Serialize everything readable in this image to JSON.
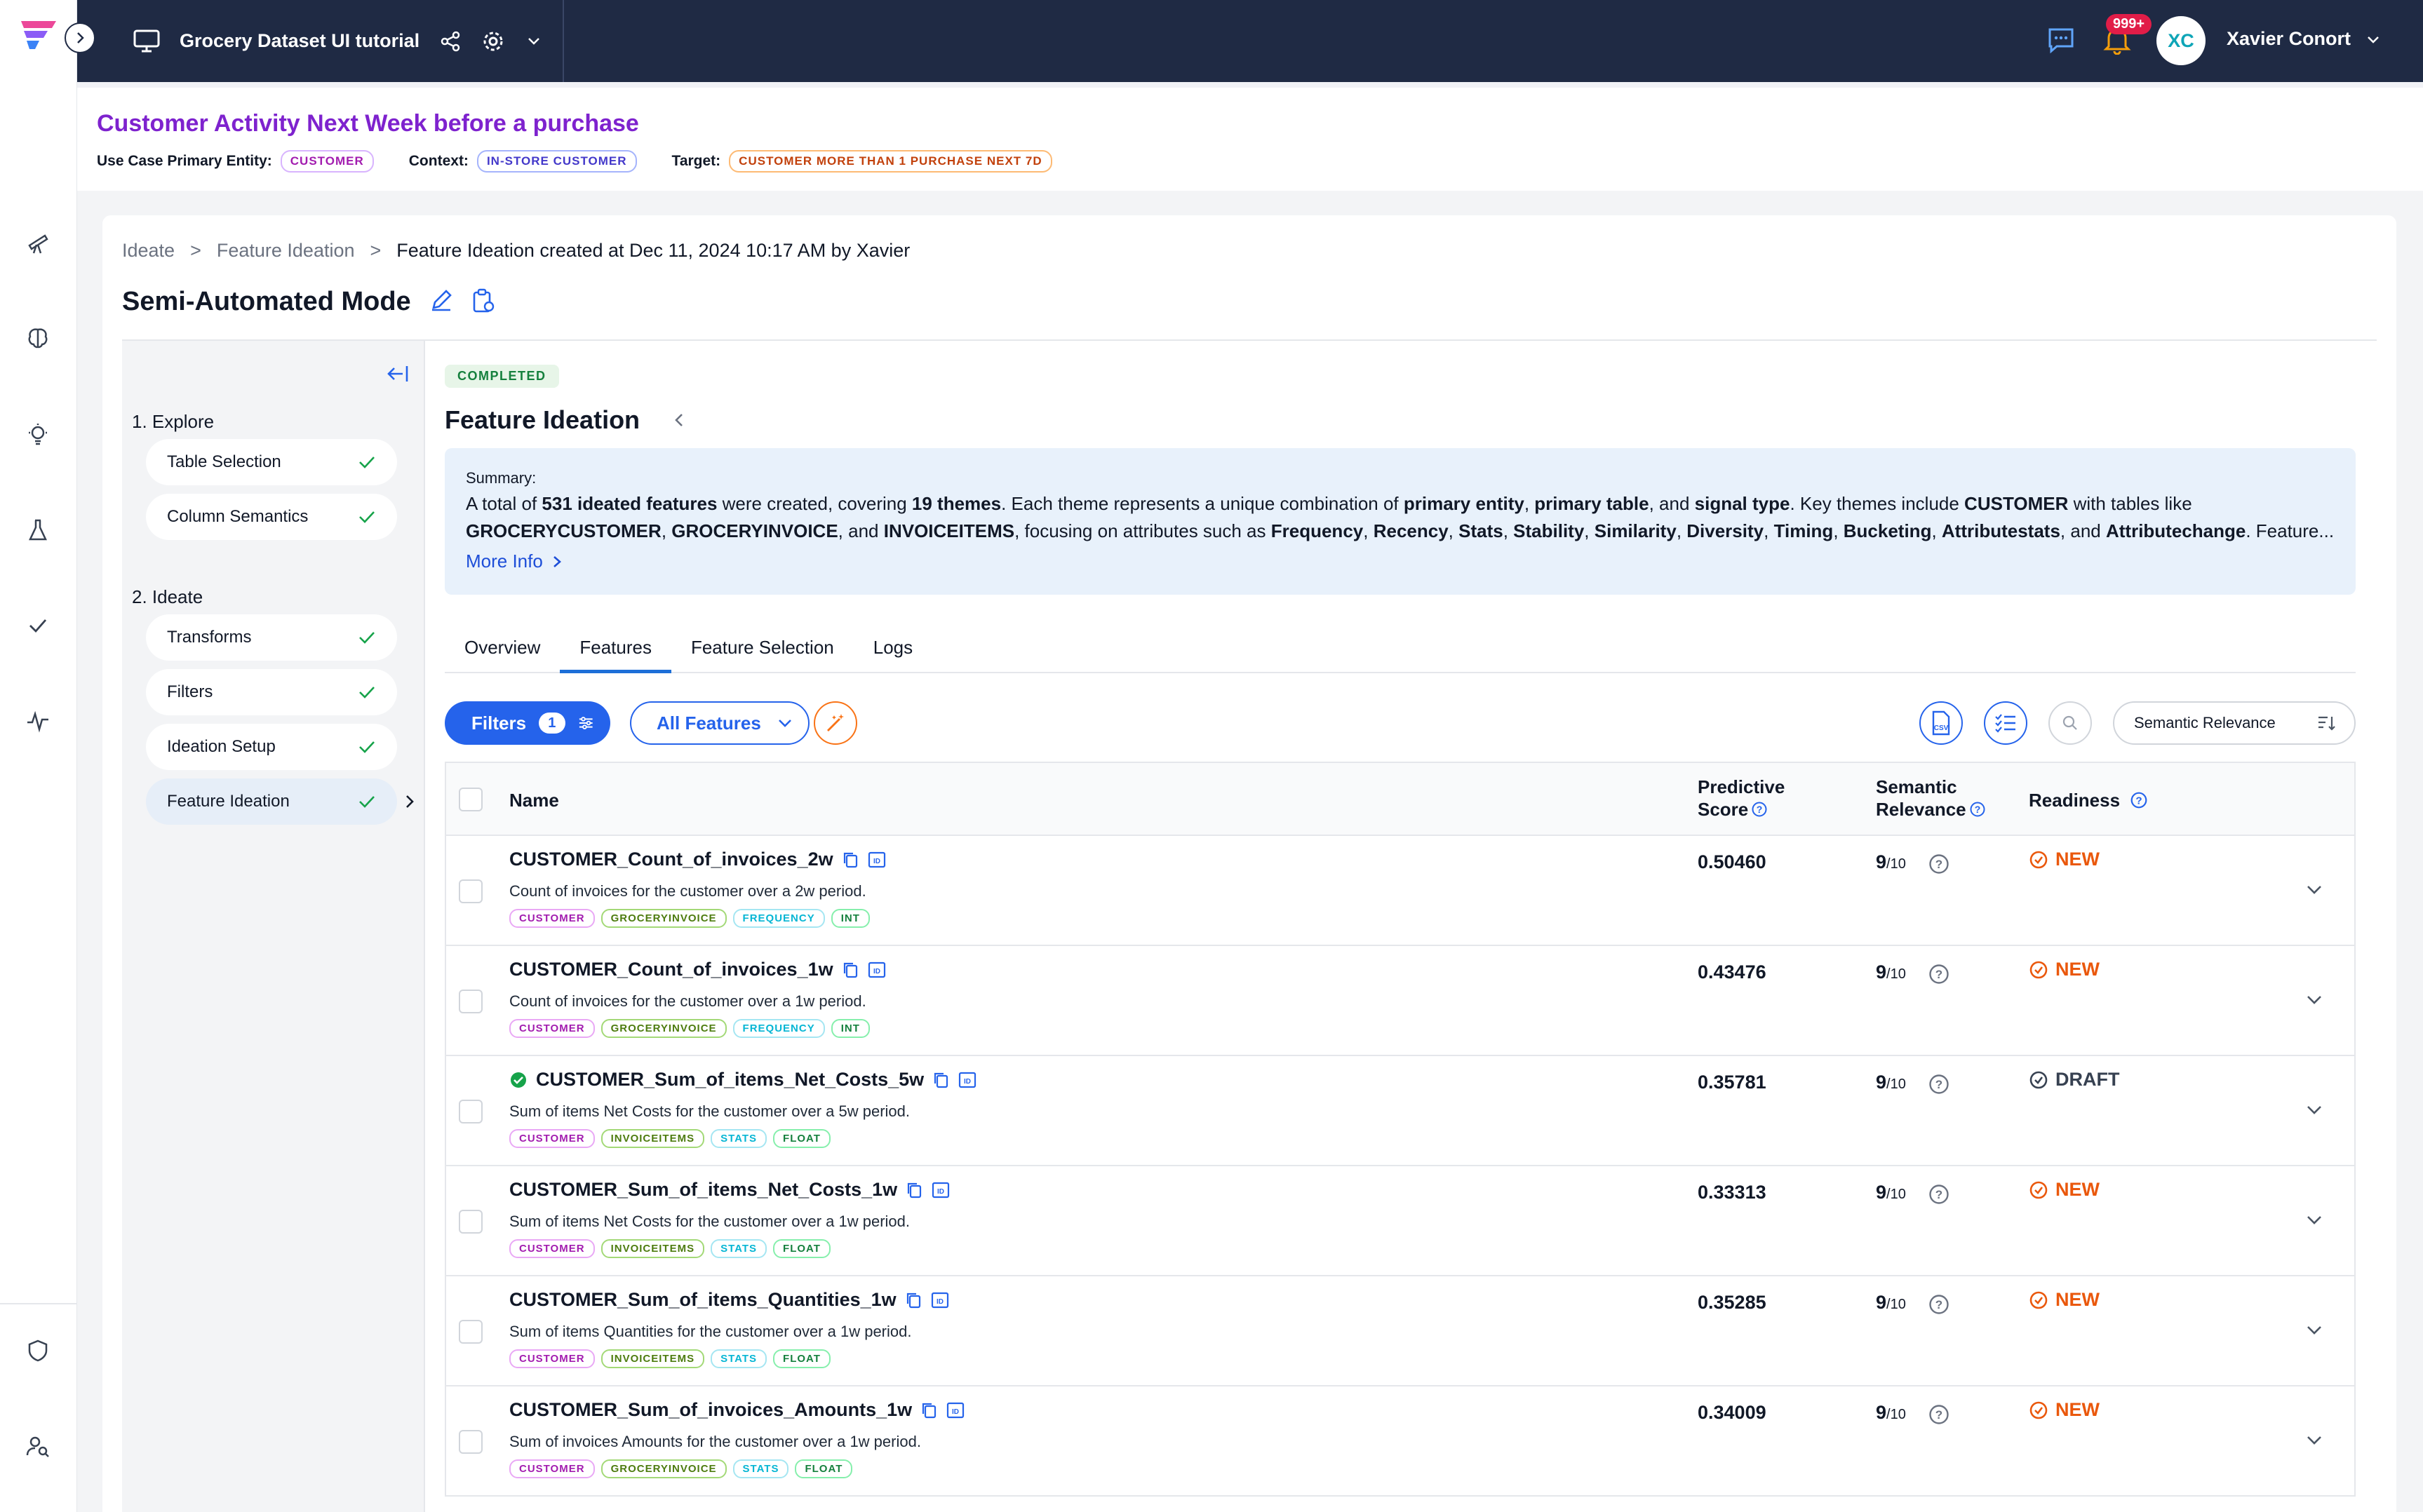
{
  "topbar": {
    "project_title": "Grocery Dataset UI tutorial",
    "notifications_badge": "999+",
    "avatar_initials": "XC",
    "user_name": "Xavier Conort"
  },
  "usecase": {
    "title": "Customer Activity Next Week before a purchase",
    "entity_label": "Use Case Primary Entity:",
    "entity_value": "CUSTOMER",
    "context_label": "Context:",
    "context_value": "IN-STORE CUSTOMER",
    "target_label": "Target:",
    "target_value": "CUSTOMER MORE THAN 1 PURCHASE NEXT 7D"
  },
  "breadcrumb": {
    "items": [
      "Ideate",
      ">",
      "Feature Ideation",
      ">"
    ],
    "current": "Feature Ideation created at Dec 11, 2024 10:17 AM by Xavier"
  },
  "mode_title": "Semi-Automated Mode",
  "stepper": {
    "explore_heading": "1. Explore",
    "ideate_heading": "2. Ideate",
    "explore_items": [
      "Table Selection",
      "Column Semantics"
    ],
    "ideate_items": [
      "Transforms",
      "Filters",
      "Ideation Setup",
      "Feature Ideation"
    ]
  },
  "content": {
    "status": "COMPLETED",
    "title": "Feature Ideation",
    "summary": {
      "label": "Summary:",
      "t1": "A total of ",
      "b1": "531 ideated features",
      "t2": " were created, covering ",
      "b2": "19 themes",
      "t3": ". Each theme represents a unique combination of ",
      "b3": "primary entity",
      "t4": ", ",
      "b4": "primary table",
      "t5": ", and ",
      "b5": "signal type",
      "t6": ". Key themes include ",
      "b6": "CUSTOMER",
      "t7": " with tables like",
      "b7": "GROCERYCUSTOMER",
      "t8": ", ",
      "b8": "GROCERYINVOICE",
      "t9": ", and ",
      "b9": "INVOICEITEMS",
      "t10": ", focusing on attributes such as ",
      "b10": "Frequency",
      "t11": ", ",
      "b11": "Recency",
      "t12": ", ",
      "b12": "Stats",
      "t13": ", ",
      "b13": "Stability",
      "t14": ", ",
      "b14": "Similarity",
      "t15": ", ",
      "b15": "Diversity",
      "t16": ", ",
      "b16": "Timing",
      "t17": ", ",
      "b17": "Bucketing",
      "t18": ", ",
      "b18": "Attributestats",
      "t19": ", and ",
      "b19": "Attributechange",
      "t20": ". Feature...",
      "more_info": "More Info"
    },
    "tabs": [
      "Overview",
      "Features",
      "Feature Selection",
      "Logs"
    ],
    "active_tab": "Features"
  },
  "toolbar": {
    "filters_label": "Filters",
    "filters_count": "1",
    "all_features_label": "All Features",
    "sort_label": "Semantic Relevance"
  },
  "table": {
    "headers": {
      "name": "Name",
      "predictive_1": "Predictive",
      "predictive_2": "Score",
      "semantic_1": "Semantic",
      "semantic_2": "Relevance",
      "readiness": "Readiness"
    },
    "rows": [
      {
        "name": "CUSTOMER_Count_of_invoices_2w",
        "desc": "Count of invoices for the customer over a 2w period.",
        "tags": [
          "CUSTOMER",
          "GROCERYINVOICE",
          "FREQUENCY",
          "INT"
        ],
        "score": "0.50460",
        "rel": "9",
        "rel_den": "/10",
        "readiness": "NEW",
        "verified": false
      },
      {
        "name": "CUSTOMER_Count_of_invoices_1w",
        "desc": "Count of invoices for the customer over a 1w period.",
        "tags": [
          "CUSTOMER",
          "GROCERYINVOICE",
          "FREQUENCY",
          "INT"
        ],
        "score": "0.43476",
        "rel": "9",
        "rel_den": "/10",
        "readiness": "NEW",
        "verified": false
      },
      {
        "name": "CUSTOMER_Sum_of_items_Net_Costs_5w",
        "desc": "Sum of items Net Costs for the customer over a 5w period.",
        "tags": [
          "CUSTOMER",
          "INVOICEITEMS",
          "STATS",
          "FLOAT"
        ],
        "score": "0.35781",
        "rel": "9",
        "rel_den": "/10",
        "readiness": "DRAFT",
        "verified": true
      },
      {
        "name": "CUSTOMER_Sum_of_items_Net_Costs_1w",
        "desc": "Sum of items Net Costs for the customer over a 1w period.",
        "tags": [
          "CUSTOMER",
          "INVOICEITEMS",
          "STATS",
          "FLOAT"
        ],
        "score": "0.33313",
        "rel": "9",
        "rel_den": "/10",
        "readiness": "NEW",
        "verified": false
      },
      {
        "name": "CUSTOMER_Sum_of_items_Quantities_1w",
        "desc": "Sum of items Quantities for the customer over a 1w period.",
        "tags": [
          "CUSTOMER",
          "INVOICEITEMS",
          "STATS",
          "FLOAT"
        ],
        "score": "0.35285",
        "rel": "9",
        "rel_den": "/10",
        "readiness": "NEW",
        "verified": false
      },
      {
        "name": "CUSTOMER_Sum_of_invoices_Amounts_1w",
        "desc": "Sum of invoices Amounts for the customer over a 1w period.",
        "tags": [
          "CUSTOMER",
          "GROCERYINVOICE",
          "STATS",
          "FLOAT"
        ],
        "score": "0.34009",
        "rel": "9",
        "rel_den": "/10",
        "readiness": "NEW",
        "verified": false
      }
    ]
  },
  "icons": {
    "brand": "logo-icon",
    "rail": [
      "telescope-icon",
      "brain-icon",
      "lightbulb-icon",
      "flask-icon",
      "check-icon",
      "pulse-icon",
      "shield-icon",
      "user-search-icon"
    ]
  },
  "colors": {
    "topbar": "#1f2a44",
    "accent": "#2563eb",
    "usecase_title": "#7e22ce",
    "new_status": "#ea580c",
    "completed": "#15803d"
  }
}
